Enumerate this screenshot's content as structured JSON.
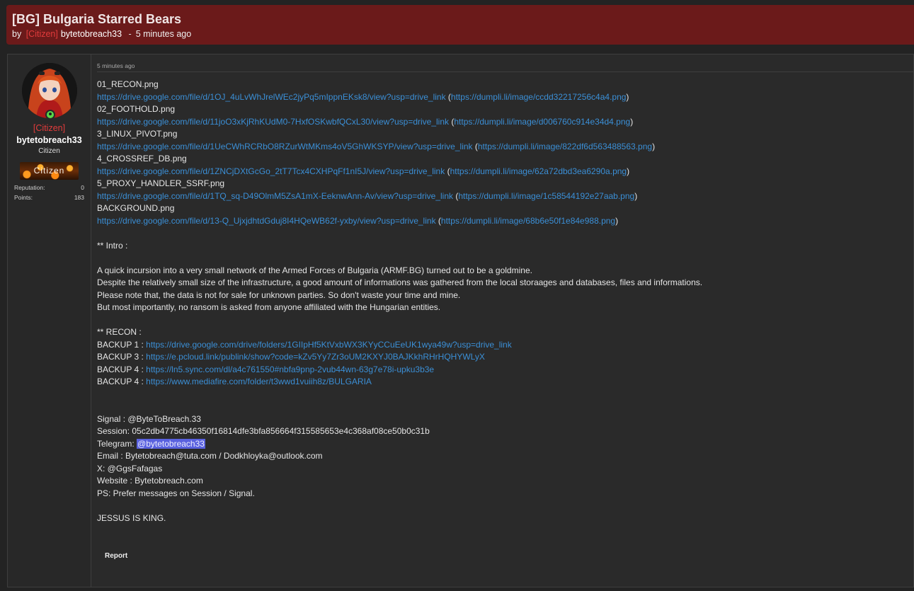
{
  "thread": {
    "title": "[BG] Bulgaria Starred Bears",
    "by_label": "by",
    "group_tag": "[Citizen]",
    "author": "bytetobreach33",
    "separator": "-",
    "time": "5 minutes ago"
  },
  "author_panel": {
    "rank_tag": "[Citizen]",
    "username": "bytetobreach33",
    "user_title": "Citizen",
    "rank_banner": "Citizen",
    "stats": [
      {
        "label": "Reputation:",
        "value": "0"
      },
      {
        "label": "Points:",
        "value": "183"
      }
    ],
    "avatar_icon": "anime-avatar-icon",
    "status_icon": "online-status-icon",
    "colors": {
      "online": "#5ad84a",
      "rank": "#e23b3b",
      "header_bg": "#6b1a1a"
    }
  },
  "post": {
    "date": "5 minutes ago",
    "files": [
      {
        "name": "01_RECON.png",
        "drive": "https://drive.google.com/file/d/1OJ_4uLvWhJrelWEc2jyPq5mIppnEKsk8/view?usp=drive_link",
        "image": "https://dumpli.li/image/ccdd32217256c4a4.png"
      },
      {
        "name": "02_FOOTHOLD.png",
        "drive": "https://drive.google.com/file/d/11joO3xKjRhKUdM0-7HxfOSKwbfQCxL30/view?usp=drive_link",
        "image": "https://dumpli.li/image/d006760c914e34d4.png"
      },
      {
        "name": "3_LINUX_PIVOT.png",
        "drive": "https://drive.google.com/file/d/1UeCWhRCRbO8RZurWtMKms4oV5GhWKSYP/view?usp=drive_link",
        "image": "https://dumpli.li/image/822df6d563488563.png"
      },
      {
        "name": "4_CROSSREF_DB.png",
        "drive": "https://drive.google.com/file/d/1ZNCjDXtGcGo_2tT7Tcx4CXHPqFf1nI5J/view?usp=drive_link",
        "image": "https://dumpli.li/image/62a72dbd3ea6290a.png"
      },
      {
        "name": "5_PROXY_HANDLER_SSRF.png",
        "drive": "https://drive.google.com/file/d/1TQ_sq-D49OlmM5ZsA1mX-EeknwAnn-Av/view?usp=drive_link",
        "image": "https://dumpli.li/image/1c58544192e27aab.png"
      },
      {
        "name": "BACKGROUND.png",
        "drive": "https://drive.google.com/file/d/13-Q_UjxjdhtdGduj8I4HQeWB62f-yxby/view?usp=drive_link",
        "image": "https://dumpli.li/image/68b6e50f1e84e988.png"
      }
    ],
    "paren_open": "(",
    "paren_close": ")",
    "intro_heading": "** Intro :",
    "intro_lines": [
      "A quick incursion into a very small network of the Armed Forces of Bulgaria (ARMF.BG) turned out to be a goldmine.",
      "Despite the relatively small size of the infrastructure, a good amount of informations was gathered from the local storaages and databases, files and informations.",
      "Please note that, the data is not for sale for unknown parties. So don't waste your time and mine.",
      "But most importantly, no ransom is asked from anyone affiliated with the Hungarian entities."
    ],
    "recon_heading": "** RECON :",
    "backups": [
      {
        "label": "BACKUP 1 : ",
        "url": "https://drive.google.com/drive/folders/1GIIpHf5KtVxbWX3KYyCCuEeUK1wya49w?usp=drive_link"
      },
      {
        "label": "BACKUP 3 : ",
        "url": "https://e.pcloud.link/publink/show?code=kZv5Yy7Zr3oUM2KXYJ0BAJKkhRHrHQHYWLyX"
      },
      {
        "label": "BACKUP 4 : ",
        "url": "https://ln5.sync.com/dl/a4c761550#nbfa9pnp-2vub44wn-63g7e78i-upku3b3e"
      },
      {
        "label": "BACKUP 4 : ",
        "url": "https://www.mediafire.com/folder/t3wwd1vuiih8z/BULGARIA"
      }
    ],
    "contact": {
      "signal": "Signal : @ByteToBreach.33",
      "session": "Session: 05c2db4775cb46350f16814dfe3bfa856664f315585653e4c368af08ce50b0c31b",
      "telegram_label": "Telegram: ",
      "telegram_handle": "@bytetobreach33",
      "email": "Email : Bytetobreach@tuta.com / Dodkhloyka@outlook.com",
      "x": "X: @GgsFafagas",
      "website": "Website : Bytetobreach.com",
      "ps": "PS: Prefer messages on Session / Signal."
    },
    "closing": "JESSUS IS KING.",
    "report_label": "Report"
  }
}
